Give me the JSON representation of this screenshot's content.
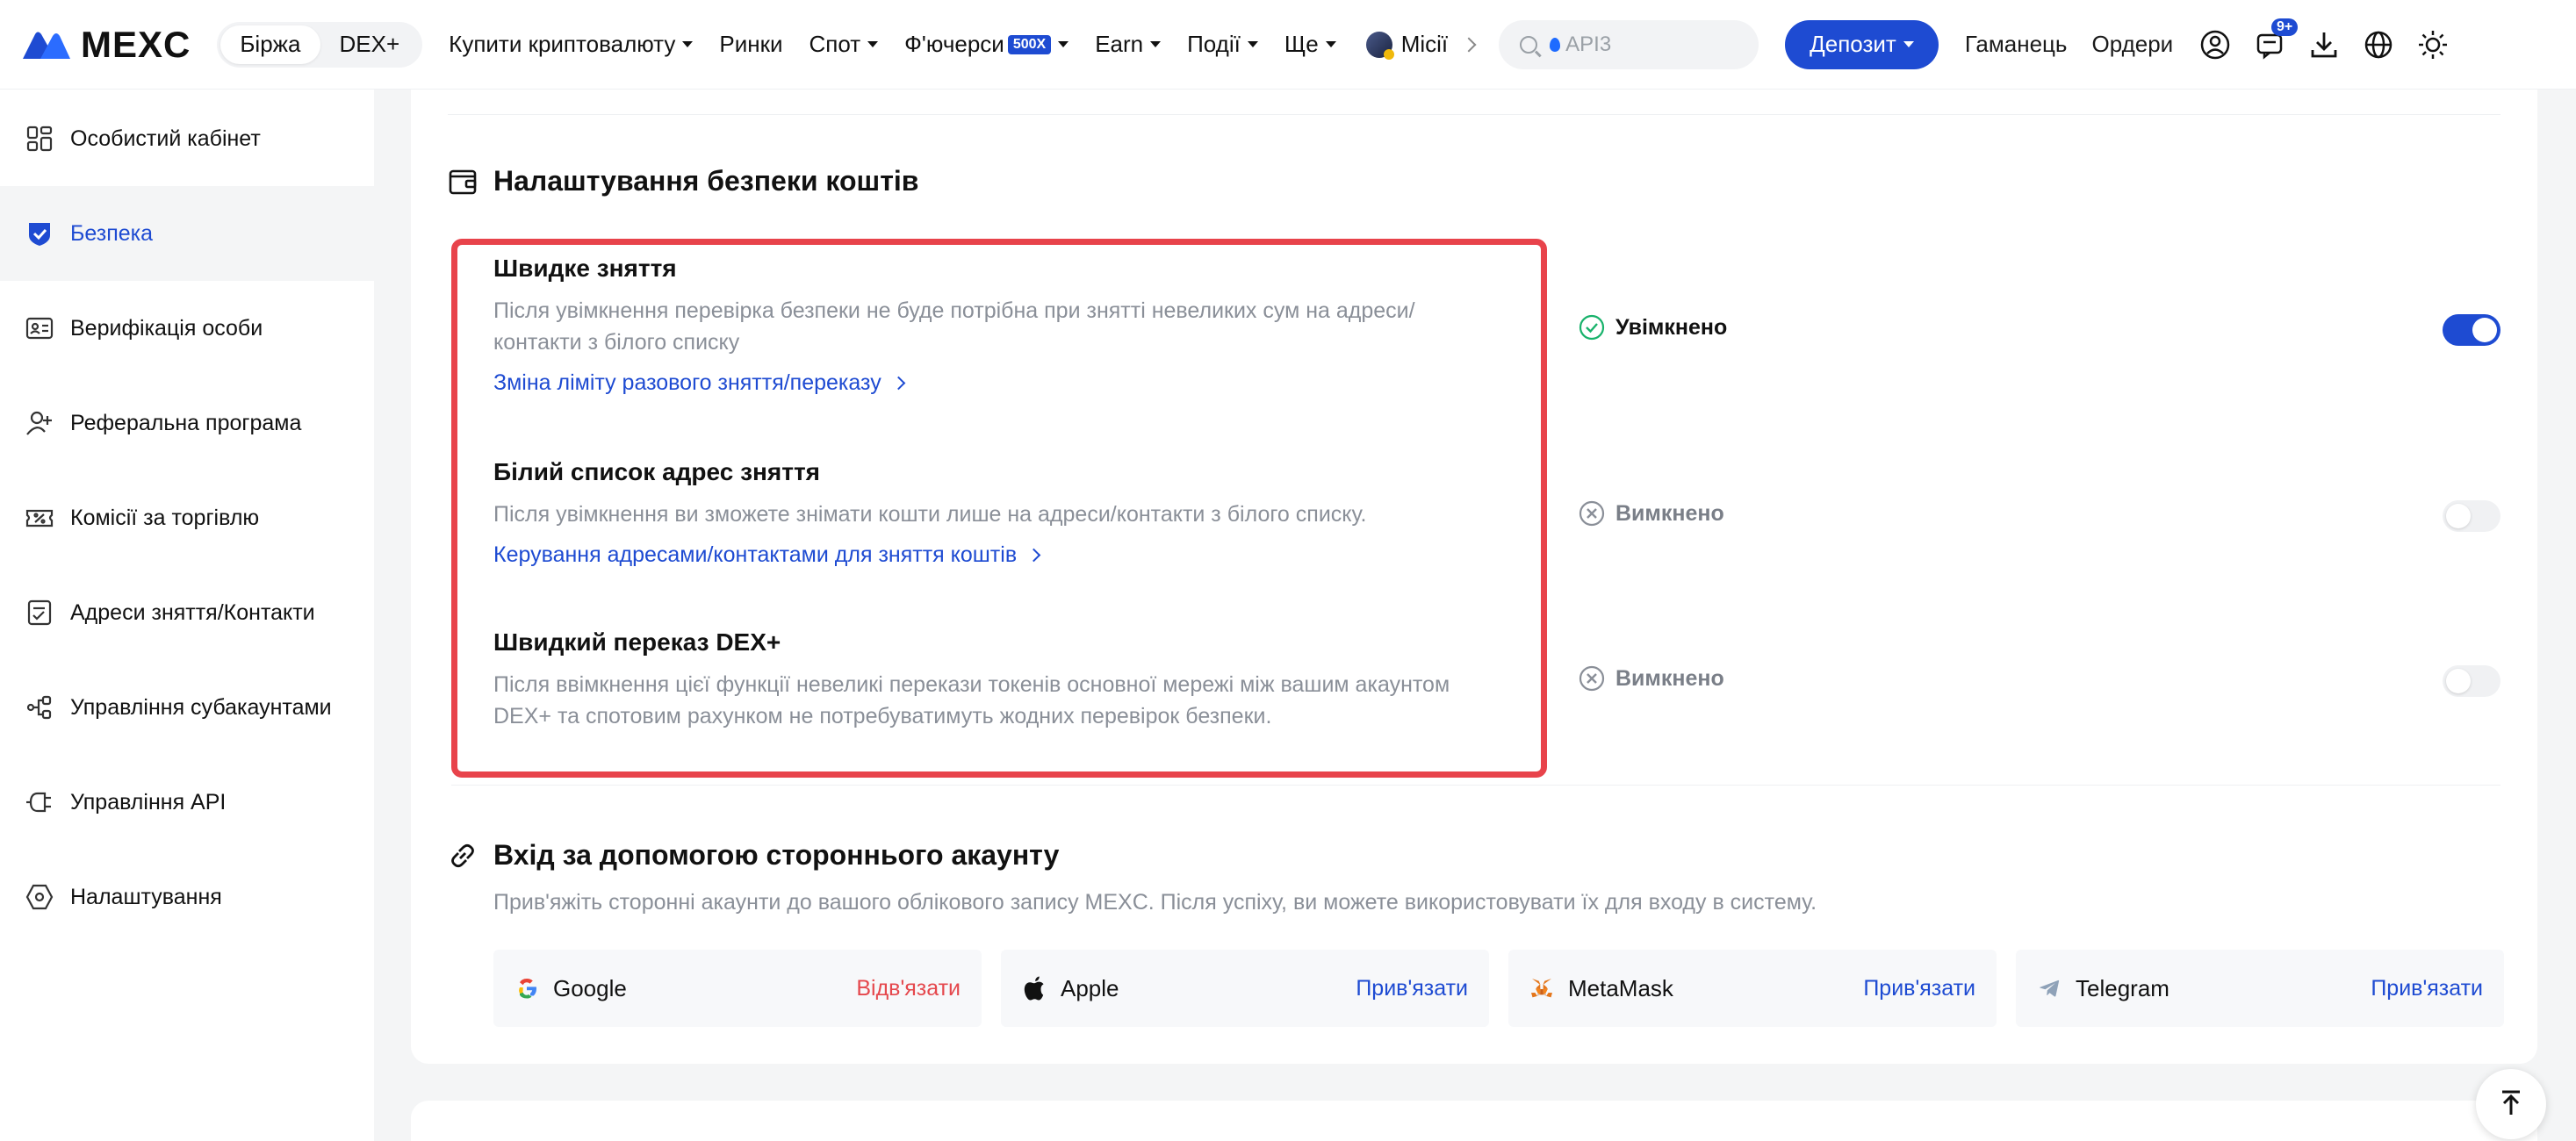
{
  "brand": {
    "name": "MEXC",
    "accent": "#1e4bd2",
    "danger": "#e5484d",
    "highlight": "#e8434b"
  },
  "topnav": {
    "segment": [
      "Біржа",
      "DEX+"
    ],
    "links": {
      "buy_crypto": "Купити криптовалюту",
      "markets": "Ринки",
      "spot": "Спот",
      "futures": "Ф'ючерси",
      "futures_badge": "500X",
      "earn": "Earn",
      "events": "Події",
      "more": "Ще",
      "missions": "Місії"
    },
    "search_placeholder": "API3",
    "deposit": "Депозит",
    "wallet": "Гаманець",
    "orders": "Ордери",
    "notif_badge": "9+"
  },
  "sidebar": {
    "items": [
      {
        "label": "Особистий кабінет",
        "icon": "dashboard-icon"
      },
      {
        "label": "Безпека",
        "icon": "shield-icon",
        "active": true
      },
      {
        "label": "Верифікація особи",
        "icon": "id-card-icon"
      },
      {
        "label": "Реферальна програма",
        "icon": "add-user-icon"
      },
      {
        "label": "Комісії за торгівлю",
        "icon": "ticket-icon"
      },
      {
        "label": "Адреси зняття/Контакти",
        "icon": "address-book-icon"
      },
      {
        "label": "Управління субакаунтами",
        "icon": "subaccount-icon"
      },
      {
        "label": "Управління API",
        "icon": "api-plug-icon"
      },
      {
        "label": "Налаштування",
        "icon": "hexagon-settings-icon"
      }
    ]
  },
  "fund_security": {
    "title": "Налаштування безпеки коштів",
    "options": [
      {
        "title": "Швидке зняття",
        "desc": "Після увімкнення перевірка безпеки не буде потрібна при знятті невеликих сум на адреси/ контакти з білого списку",
        "link": "Зміна ліміту разового зняття/переказу",
        "status": "Увімкнено",
        "enabled": true
      },
      {
        "title": "Білий список адрес зняття",
        "desc": "Після увімкнення ви зможете знімати кошти лише на адреси/контакти з білого списку.",
        "link": "Керування адресами/контактами для зняття коштів",
        "status": "Вимкнено",
        "enabled": false
      },
      {
        "title": "Швидкий переказ DEX+",
        "desc": "Після ввімкнення цієї функції невеликі перекази токенів основної мережі між вашим акаунтом DEX+ та спотовим рахунком не потребуватимуть жодних перевірок безпеки.",
        "status": "Вимкнено",
        "enabled": false
      }
    ]
  },
  "third_party": {
    "title": "Вхід за допомогою стороннього акаунту",
    "desc": "Прив'яжіть сторонні акаунти до вашого облікового запису MEXC. Після успіху, ви можете використовувати їх для входу в систему.",
    "accounts": [
      {
        "name": "Google",
        "action": "Відв'язати",
        "bound": true
      },
      {
        "name": "Apple",
        "action": "Прив'язати",
        "bound": false
      },
      {
        "name": "MetaMask",
        "action": "Прив'язати",
        "bound": false
      },
      {
        "name": "Telegram",
        "action": "Прив'язати",
        "bound": false
      }
    ]
  }
}
